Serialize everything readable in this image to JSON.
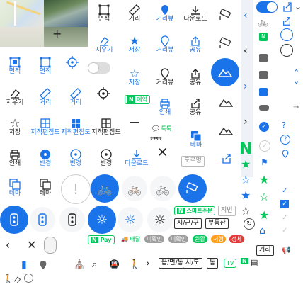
{
  "labels": {
    "area": "면적",
    "distance": "거리",
    "distance_view": "거리뷰",
    "download": "다운로드",
    "zoom_out": "지우기",
    "save": "저장",
    "share": "공유",
    "reserve": "예약",
    "print": "인쇄",
    "radius": "반경",
    "theme": "테마",
    "cadastral": "지적편집도",
    "talk": "톡톡",
    "road_name": "도로명",
    "smart_order": "스마트주문",
    "lot_number": "지번",
    "city_district": "시/군/구",
    "real_estate": "부동산",
    "pay": "Pay",
    "delivery": "배달",
    "unconfirmed": "미확인",
    "smooth": "원활",
    "slow": "서행",
    "congested": "정체",
    "eup_myeon_dong": "읍/면/동",
    "city_province": "시/도",
    "dong": "동",
    "tv": "TV",
    "distance_box": "거리",
    "n_logo": "N"
  },
  "colors": {
    "accent": "#1a73e8",
    "green": "#03c75a",
    "gray": "#9e9e9e",
    "orange": "#ff9f1c",
    "red": "#e53935"
  }
}
